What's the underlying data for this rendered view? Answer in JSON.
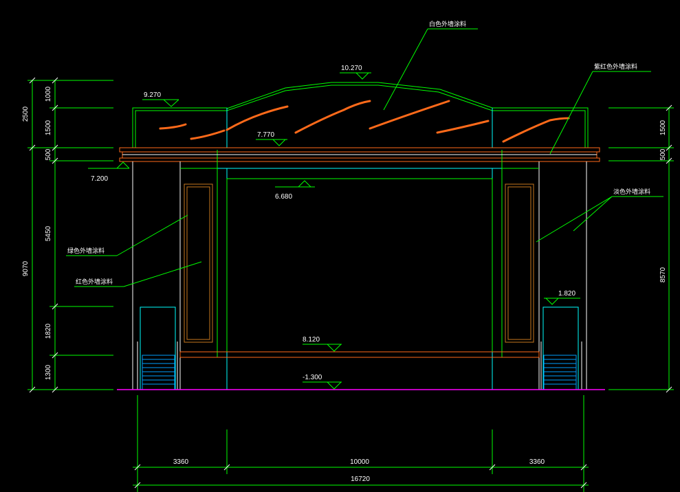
{
  "colors": {
    "background": "#000000",
    "dimension": "#00ff00",
    "outline": "#ffffff",
    "cyan": "#00ffff",
    "orange": "#ff6a1a",
    "brown": "#c8781e",
    "magenta": "#ff00ff",
    "olive": "#c0c000"
  },
  "labels": {
    "white_coating": "白色外墙涂料",
    "purple_red_coating": "紫红色外墙涂料",
    "light_coating": "淡色外墙涂料",
    "green_coating": "绿色外墙涂料",
    "red_coating": "红色外墙涂料"
  },
  "elevations": {
    "top": "10.270",
    "left_top": "9.270",
    "beam_top": "7.770",
    "beam_bottom": "7.200",
    "inner": "6.680",
    "door": "1.820",
    "sill": "8.120",
    "ground": "-1.300"
  },
  "dims_left": {
    "d1000": "1000",
    "d1500": "1500",
    "d2500": "2500",
    "d500": "500",
    "d5450": "5450",
    "d9070": "9070",
    "d1820": "1820",
    "d1300": "1300"
  },
  "dims_right": {
    "d1500": "1500",
    "d500": "500",
    "d8570": "8570"
  },
  "dims_bottom": {
    "left": "3360",
    "middle": "10000",
    "right": "3360",
    "total": "16720"
  }
}
